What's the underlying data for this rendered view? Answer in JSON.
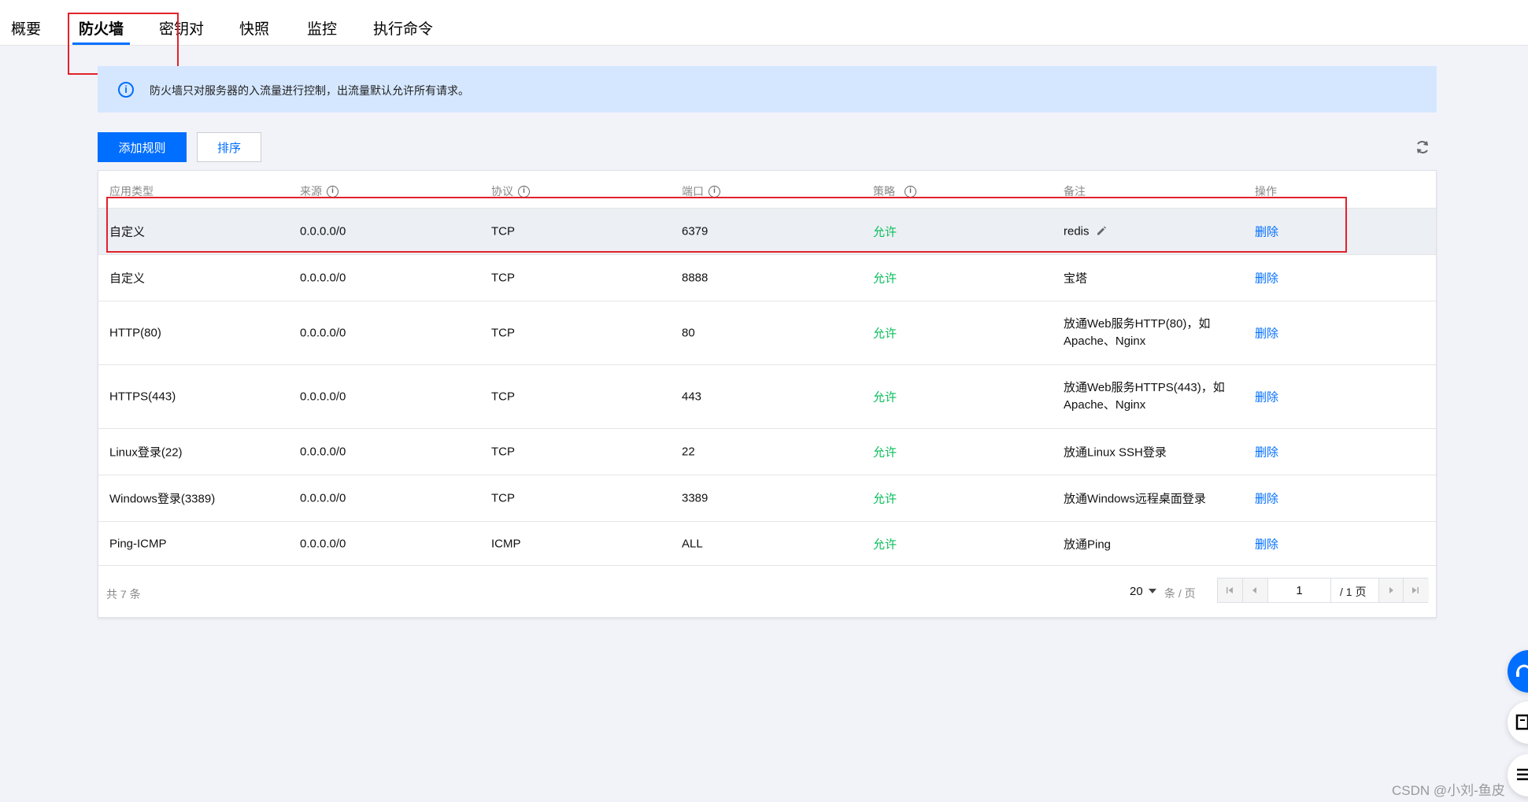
{
  "tabs": [
    {
      "label": "概要",
      "active": false
    },
    {
      "label": "防火墙",
      "active": true
    },
    {
      "label": "密钥对",
      "active": false
    },
    {
      "label": "快照",
      "active": false
    },
    {
      "label": "监控",
      "active": false
    },
    {
      "label": "执行命令",
      "active": false
    }
  ],
  "notice": {
    "icon": "info-icon",
    "text": "防火墙只对服务器的入流量进行控制，出流量默认允许所有请求。"
  },
  "toolbar": {
    "add_rule_label": "添加规则",
    "sort_label": "排序",
    "refresh_icon": "refresh-icon"
  },
  "table": {
    "columns": [
      "应用类型",
      "来源",
      "协议",
      "端口",
      "策略",
      "备注",
      "操作"
    ],
    "rows": [
      {
        "app": "自定义",
        "source": "0.0.0.0/0",
        "protocol": "TCP",
        "port": "6379",
        "policy": "允许",
        "note": "redis",
        "action": "删除"
      },
      {
        "app": "自定义",
        "source": "0.0.0.0/0",
        "protocol": "TCP",
        "port": "8888",
        "policy": "允许",
        "note": "宝塔",
        "action": "删除"
      },
      {
        "app": "HTTP(80)",
        "source": "0.0.0.0/0",
        "protocol": "TCP",
        "port": "80",
        "policy": "允许",
        "note": "放通Web服务HTTP(80)，如Apache、Nginx",
        "action": "删除"
      },
      {
        "app": "HTTPS(443)",
        "source": "0.0.0.0/0",
        "protocol": "TCP",
        "port": "443",
        "policy": "允许",
        "note": "放通Web服务HTTPS(443)，如Apache、Nginx",
        "action": "删除"
      },
      {
        "app": "Linux登录(22)",
        "source": "0.0.0.0/0",
        "protocol": "TCP",
        "port": "22",
        "policy": "允许",
        "note": "放通Linux SSH登录",
        "action": "删除"
      },
      {
        "app": "Windows登录(3389)",
        "source": "0.0.0.0/0",
        "protocol": "TCP",
        "port": "3389",
        "policy": "允许",
        "note": "放通Windows远程桌面登录",
        "action": "删除"
      },
      {
        "app": "Ping-ICMP",
        "source": "0.0.0.0/0",
        "protocol": "ICMP",
        "port": "ALL",
        "policy": "允许",
        "note": "放通Ping",
        "action": "删除"
      }
    ]
  },
  "footer": {
    "total_text": "共 7 条",
    "page_size": "20",
    "per_page_text": "条 / 页",
    "current_page": "1",
    "total_pages_text": "/ 1 页"
  },
  "watermark": "CSDN @小刘-鱼皮",
  "colors": {
    "primary": "#006eff",
    "allow": "#0abf5b",
    "annotation_red": "#e2222b",
    "notice_bg": "#d5e7ff"
  }
}
